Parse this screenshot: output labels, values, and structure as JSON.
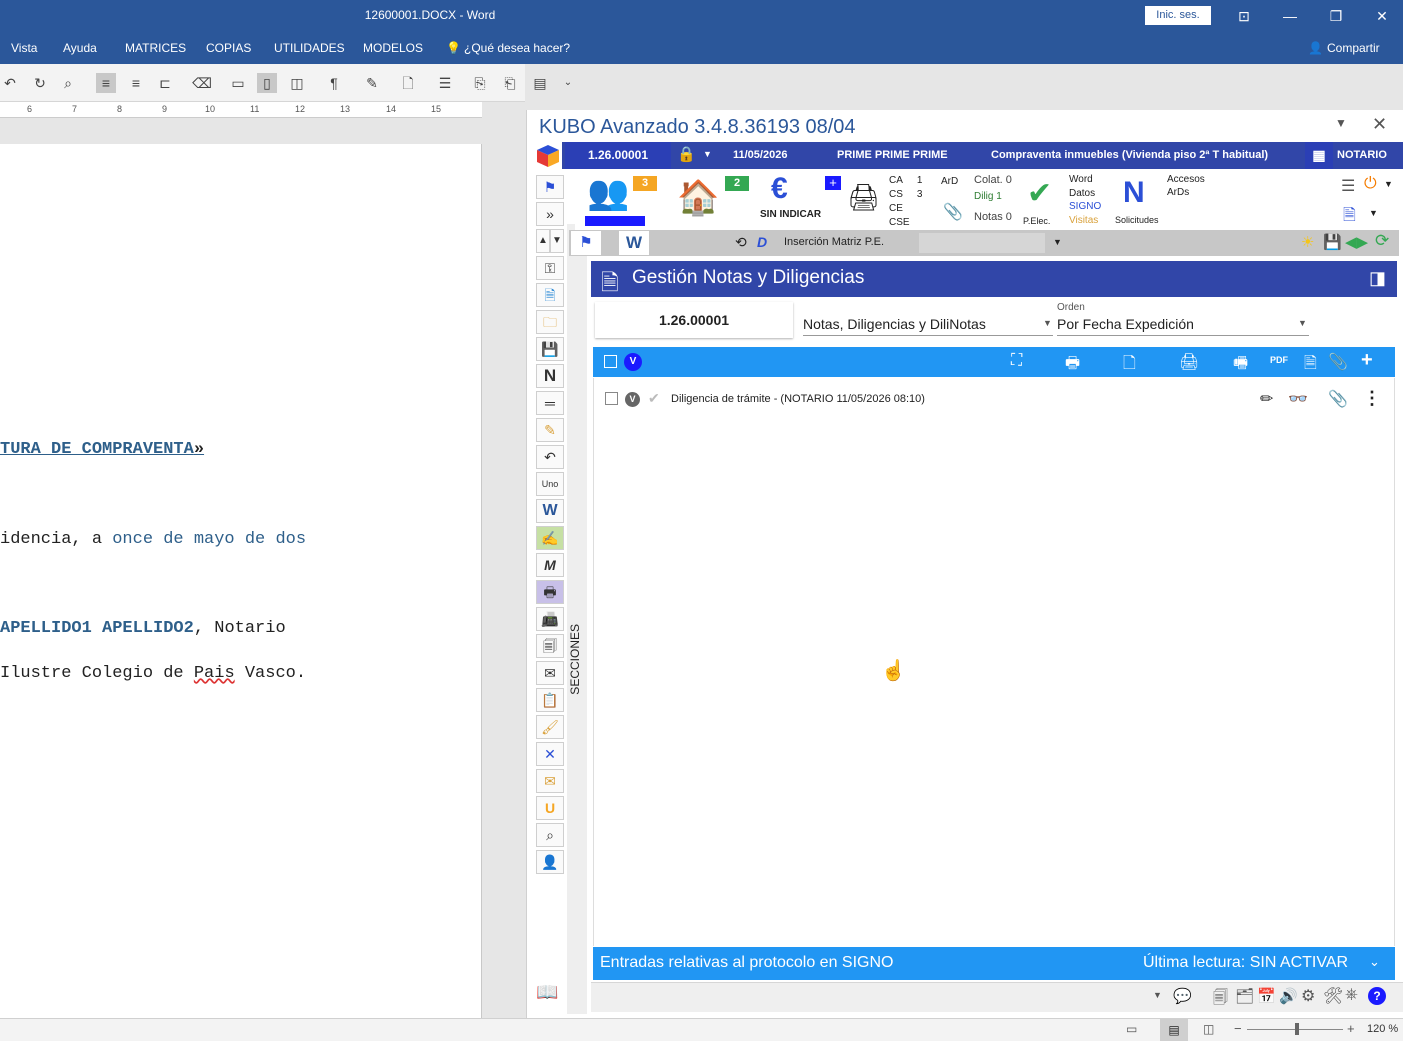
{
  "word": {
    "title": "12600001.DOCX  -  Word",
    "signin": "Inic. ses.",
    "menu": [
      "Vista",
      "Ayuda",
      "MATRICES",
      "COPIAS",
      "UTILIDADES",
      "MODELOS"
    ],
    "tell_me": "¿Qué desea hacer?",
    "share": "Compartir",
    "ruler_numbers": [
      "6",
      "7",
      "8",
      "9",
      "10",
      "11",
      "12",
      "13",
      "14",
      "15"
    ],
    "doc_lines": {
      "title_fragment": "TURA DE COMPRAVENTA",
      "title_quote": "»",
      "line2_a": "idencia, a ",
      "line2_b": "once de mayo de dos",
      "line3_a": " APELLIDO1 APELLIDO2",
      "line3_b": ", Notario",
      "line4_a": "Ilustre Colegio de ",
      "line4_b": "Pais",
      "line4_c": " Vasco."
    },
    "zoom": "120 %"
  },
  "kubo": {
    "title": "KUBO Avanzado 3.4.8.36193   08/04",
    "protocol": "1.26.00001",
    "date": "11/05/2026",
    "names": "PRIME PRIME PRIME",
    "operation": "Compraventa inmuebles (Vivienda piso 2ª T habitual)",
    "role": "NOTARIO",
    "badges": {
      "intervinientes": "3",
      "inmuebles": "2"
    },
    "sin_indicar": "SIN INDICAR",
    "counters": {
      "ca": "CA",
      "ca_v": "1",
      "cs": "CS",
      "cs_v": "3",
      "ce": "CE",
      "cse": "CSE",
      "ard": "ArD",
      "colat": "Colat. 0",
      "dilig": "Dilig 1",
      "notas": "Notas 0"
    },
    "pelec": "P.Elec.",
    "word_datos": [
      "Word",
      "Datos",
      "SIGNO",
      "Visitas"
    ],
    "solicitudes": "Solicitudes",
    "accesos": [
      "Accesos",
      "ArDs"
    ],
    "insercion": "Inserción Matriz P.E.",
    "secciones": "SECCIONES",
    "panel_title": "Gestión Notas y Diligencias",
    "filter_protocol": "1.26.00001",
    "filter_type": "Notas, Diligencias y DiliNotas",
    "order_label": "Orden",
    "order_value": "Por Fecha Expedición",
    "header_badge": "V",
    "entries": [
      {
        "badge": "V",
        "text": "Diligencia de trámite - (NOTARIO 11/05/2026 08:10)"
      }
    ],
    "footer_left": "Entradas relativas al protocolo en SIGNO",
    "footer_right": "Última lectura: SIN ACTIVAR"
  },
  "colors": {
    "word_blue": "#2b579a",
    "kubo_indigo": "#3146a8",
    "list_blue": "#2196f3",
    "badge_orange": "#f5a623",
    "badge_green": "#34a853"
  }
}
